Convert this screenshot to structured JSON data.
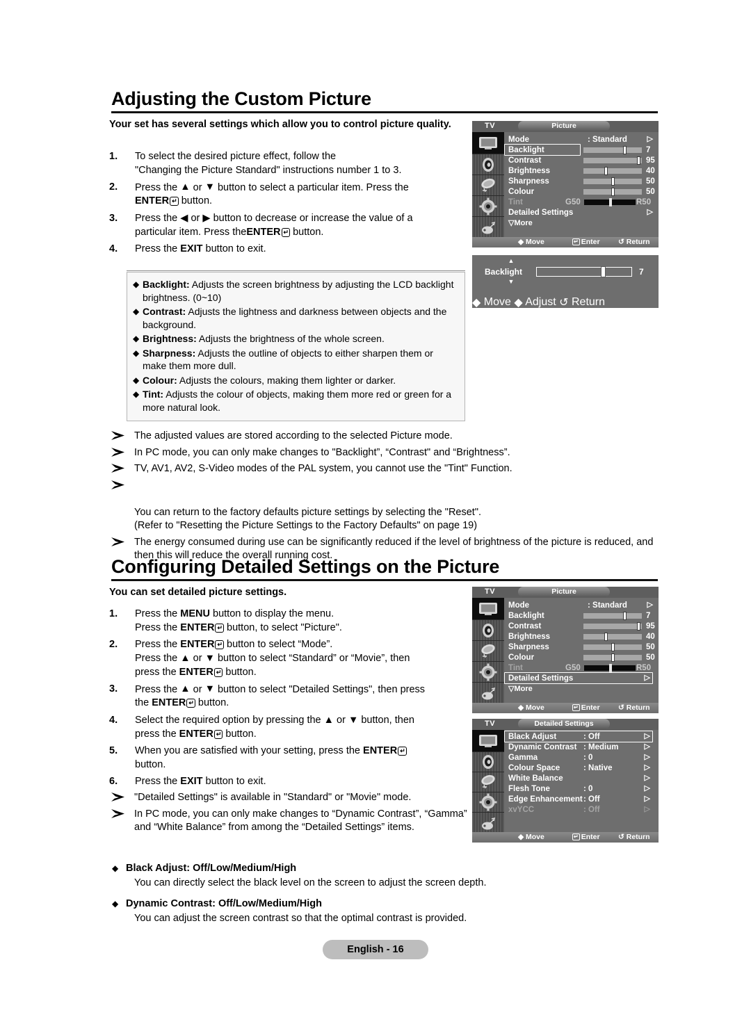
{
  "page": {
    "footer_badge": "English - 16"
  },
  "section1": {
    "heading": "Adjusting the Custom Picture",
    "lead": "Your set has several settings which allow you to control picture quality.",
    "steps": [
      {
        "n": "1.",
        "lines": [
          "To select the desired picture effect, follow the",
          "\"Changing the Picture Standard\" instructions number 1 to 3."
        ]
      },
      {
        "n": "2.",
        "lines": [
          "Press the ▲ or ▼ button to select a particular item. Press the",
          "ENTER button."
        ]
      },
      {
        "n": "3.",
        "lines": [
          "Press the ◀ or ▶ button to decrease or increase the value of a",
          "particular item. Press theENTER button."
        ]
      },
      {
        "n": "4.",
        "lines": [
          "Press the EXIT button to exit."
        ]
      }
    ],
    "definitions": [
      {
        "term": "Backlight:",
        "desc": " Adjusts the screen brightness by adjusting the LCD backlight brightness. (0~10)"
      },
      {
        "term": "Contrast:",
        "desc": " Adjusts the lightness and darkness between objects and the background."
      },
      {
        "term": "Brightness:",
        "desc": " Adjusts the brightness of the whole screen."
      },
      {
        "term": "Sharpness:",
        "desc": " Adjusts the outline of objects to either sharpen them or make them more dull."
      },
      {
        "term": "Colour:",
        "desc": " Adjusts the colours, making them lighter or darker."
      },
      {
        "term": "Tint:",
        "desc": " Adjusts the colour of objects, making them more red or green for a more natural look."
      }
    ],
    "notes": [
      "The adjusted values are stored according to the selected Picture mode.",
      "In PC mode, you can only make changes to \"Backlight”, “Contrast\" and  “Brightness”.",
      "TV, AV1, AV2, S-Video modes of the PAL system, you cannot use the \"Tint\" Function.",
      "You can return to the factory defaults picture settings by selecting the \"Reset\".\n(Refer to \"Resetting the Picture Settings to the Factory Defaults\" on page 19)",
      "The energy consumed during use can be significantly reduced if the level of brightness of the picture is reduced, and then this will reduce the overall running cost."
    ]
  },
  "section2": {
    "heading": "Configuring Detailed Settings on the Picture",
    "lead": "You can set detailed picture settings.",
    "steps": [
      {
        "n": "1.",
        "lines": [
          "Press the MENU button to display the menu.",
          "Press the ENTER button, to select \"Picture\"."
        ]
      },
      {
        "n": "2.",
        "lines": [
          "Press the ENTER button to select “Mode”.",
          "Press the ▲ or ▼ button to select “Standard” or “Movie”, then press the ENTER button."
        ]
      },
      {
        "n": "3.",
        "lines": [
          "Press the ▲ or ▼ button to select \"Detailed Settings\", then press the ENTER button."
        ]
      },
      {
        "n": "4.",
        "lines": [
          "Select the required option by pressing the ▲ or ▼ button, then press the ENTER button."
        ]
      },
      {
        "n": "5.",
        "lines": [
          "When you are satisfied with your setting, press the ENTER button."
        ]
      },
      {
        "n": "6.",
        "lines": [
          "Press the EXIT button to exit."
        ]
      }
    ],
    "notes": [
      "\"Detailed Settings\" is available in \"Standard\" or \"Movie\" mode.",
      "In PC mode, you can only make changes to “Dynamic Contrast”, “Gamma” and “White Balance” from among the “Detailed Settings” items."
    ],
    "option_sections": [
      {
        "title": "Black Adjust: Off/Low/Medium/High",
        "body": "You can directly select the black level on the screen to adjust the screen depth."
      },
      {
        "title": "Dynamic Contrast: Off/Low/Medium/High",
        "body": "You can adjust the screen contrast so that the optimal contrast is provided."
      }
    ]
  },
  "osd_picture_1": {
    "source_label": "TV",
    "title": "Picture",
    "rows": [
      {
        "label": "Mode",
        "value": ": Standard",
        "arrow": "▷",
        "type": "value",
        "highlight": false
      },
      {
        "label": "Backlight",
        "value": "7",
        "type": "slider",
        "percent": 70,
        "highlight": true
      },
      {
        "label": "Contrast",
        "value": "95",
        "type": "slider",
        "percent": 95,
        "highlight": false
      },
      {
        "label": "Brightness",
        "value": "40",
        "type": "slider",
        "percent": 40,
        "highlight": false
      },
      {
        "label": "Sharpness",
        "value": "50",
        "type": "slider",
        "percent": 50,
        "highlight": false
      },
      {
        "label": "Colour",
        "value": "50",
        "type": "slider",
        "percent": 50,
        "highlight": false
      },
      {
        "label": "Tint",
        "left": "G50",
        "right": "R50",
        "type": "tint",
        "percent": 50,
        "dim": true
      },
      {
        "label": "Detailed Settings",
        "value": "",
        "arrow": "▷",
        "type": "value",
        "highlight": false
      },
      {
        "label": "▽More",
        "type": "more"
      }
    ],
    "footer": {
      "move": "Move",
      "enter": "Enter",
      "return": "Return"
    }
  },
  "osd_backlight_popup": {
    "label": "Backlight",
    "value": "7",
    "percent": 70,
    "footer": {
      "move": "Move",
      "adjust": "Adjust",
      "return": "Return"
    }
  },
  "osd_picture_2": {
    "source_label": "TV",
    "title": "Picture",
    "rows": [
      {
        "label": "Mode",
        "value": ": Standard",
        "arrow": "▷",
        "type": "value",
        "highlight": false
      },
      {
        "label": "Backlight",
        "value": "7",
        "type": "slider",
        "percent": 70,
        "highlight": false
      },
      {
        "label": "Contrast",
        "value": "95",
        "type": "slider",
        "percent": 95,
        "highlight": false
      },
      {
        "label": "Brightness",
        "value": "40",
        "type": "slider",
        "percent": 40,
        "highlight": false
      },
      {
        "label": "Sharpness",
        "value": "50",
        "type": "slider",
        "percent": 50,
        "highlight": false
      },
      {
        "label": "Colour",
        "value": "50",
        "type": "slider",
        "percent": 50,
        "highlight": false
      },
      {
        "label": "Tint",
        "left": "G50",
        "right": "R50",
        "type": "tint",
        "percent": 50,
        "dim": true
      },
      {
        "label": "Detailed Settings",
        "value": "",
        "arrow": "▷",
        "type": "value",
        "highlight": true
      },
      {
        "label": "▽More",
        "type": "more"
      }
    ],
    "footer": {
      "move": "Move",
      "enter": "Enter",
      "return": "Return"
    }
  },
  "osd_detailed": {
    "source_label": "TV",
    "title": "Detailed Settings",
    "rows": [
      {
        "label": "Black Adjust",
        "value": ": Off",
        "arrow": "▷",
        "highlight": true
      },
      {
        "label": "Dynamic Contrast",
        "value": ": Medium",
        "arrow": "▷",
        "highlight": false
      },
      {
        "label": "Gamma",
        "value": ": 0",
        "arrow": "▷",
        "highlight": false
      },
      {
        "label": "Colour Space",
        "value": ": Native",
        "arrow": "▷",
        "highlight": false
      },
      {
        "label": "White Balance",
        "value": "",
        "arrow": "▷",
        "highlight": false
      },
      {
        "label": "Flesh Tone",
        "value": ": 0",
        "arrow": "▷",
        "highlight": false
      },
      {
        "label": "Edge Enhancement",
        "value": ": Off",
        "arrow": "▷",
        "highlight": false
      },
      {
        "label": "xvYCC",
        "value": ": Off",
        "arrow": "▷",
        "highlight": false,
        "dim": true
      }
    ],
    "footer": {
      "move": "Move",
      "enter": "Enter",
      "return": "Return"
    }
  }
}
